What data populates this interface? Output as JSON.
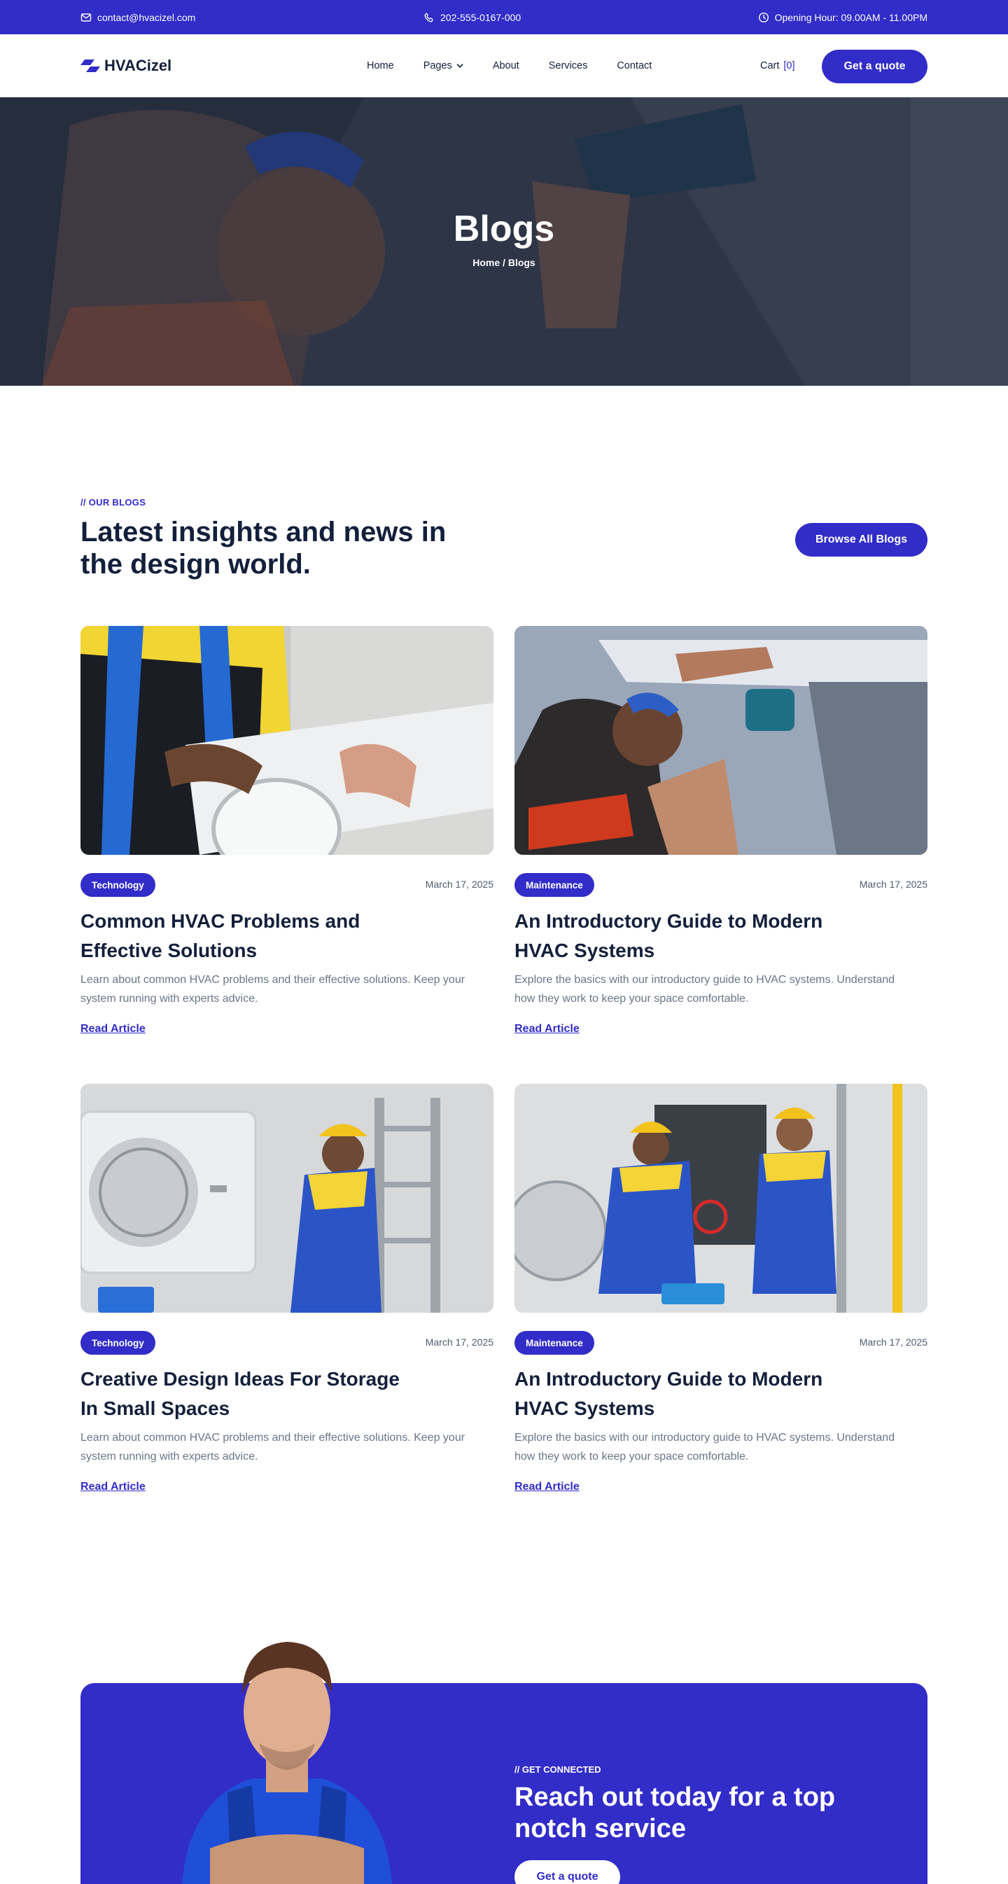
{
  "topbar": {
    "email": "contact@hvacizel.com",
    "phone": "202-555-0167-000",
    "hours": "Opening Hour: 09.00AM - 11.00PM"
  },
  "header": {
    "logo_text": "HVACizel",
    "nav": [
      "Home",
      "Pages",
      "About",
      "Services",
      "Contact"
    ],
    "cart_label": "Cart",
    "cart_count": "[0]",
    "quote_button": "Get a quote"
  },
  "hero": {
    "title": "Blogs",
    "breadcrumb": "Home / Blogs"
  },
  "blogs": {
    "eyebrow": "// OUR BLOGS",
    "title": "Latest insights and news in the design world.",
    "browse_button": "Browse All Blogs",
    "read_more_label": "Read Article",
    "posts": [
      {
        "tag": "Technology",
        "date": "March 17, 2025",
        "title": "Common HVAC Problems and Effective Solutions",
        "excerpt": "Learn about common HVAC problems and their effective solutions. Keep your system running with experts advice."
      },
      {
        "tag": "Maintenance",
        "date": "March 17, 2025",
        "title": "An Introductory Guide to Modern HVAC Systems",
        "excerpt": "Explore the basics with our introductory guide to HVAC systems. Understand how they work to keep your space comfortable."
      },
      {
        "tag": "Technology",
        "date": "March 17, 2025",
        "title": "Creative Design Ideas For Storage In Small Spaces",
        "excerpt": "Learn about common HVAC problems and their effective solutions. Keep your system running with experts advice."
      },
      {
        "tag": "Maintenance",
        "date": "March 17, 2025",
        "title": "An Introductory Guide to Modern HVAC Systems",
        "excerpt": "Explore the basics with our introductory guide to HVAC systems. Understand how they work to keep your space comfortable."
      }
    ]
  },
  "cta": {
    "eyebrow": "// GET CONNECTED",
    "title": "Reach out today for a top notch service",
    "button": "Get a quote"
  },
  "colors": {
    "brand": "#322cc8",
    "heading": "#13203b",
    "body_text": "#6b7488"
  },
  "icons": [
    "mail-icon",
    "phone-icon",
    "clock-icon",
    "chevron-down-icon",
    "logo-icon"
  ]
}
